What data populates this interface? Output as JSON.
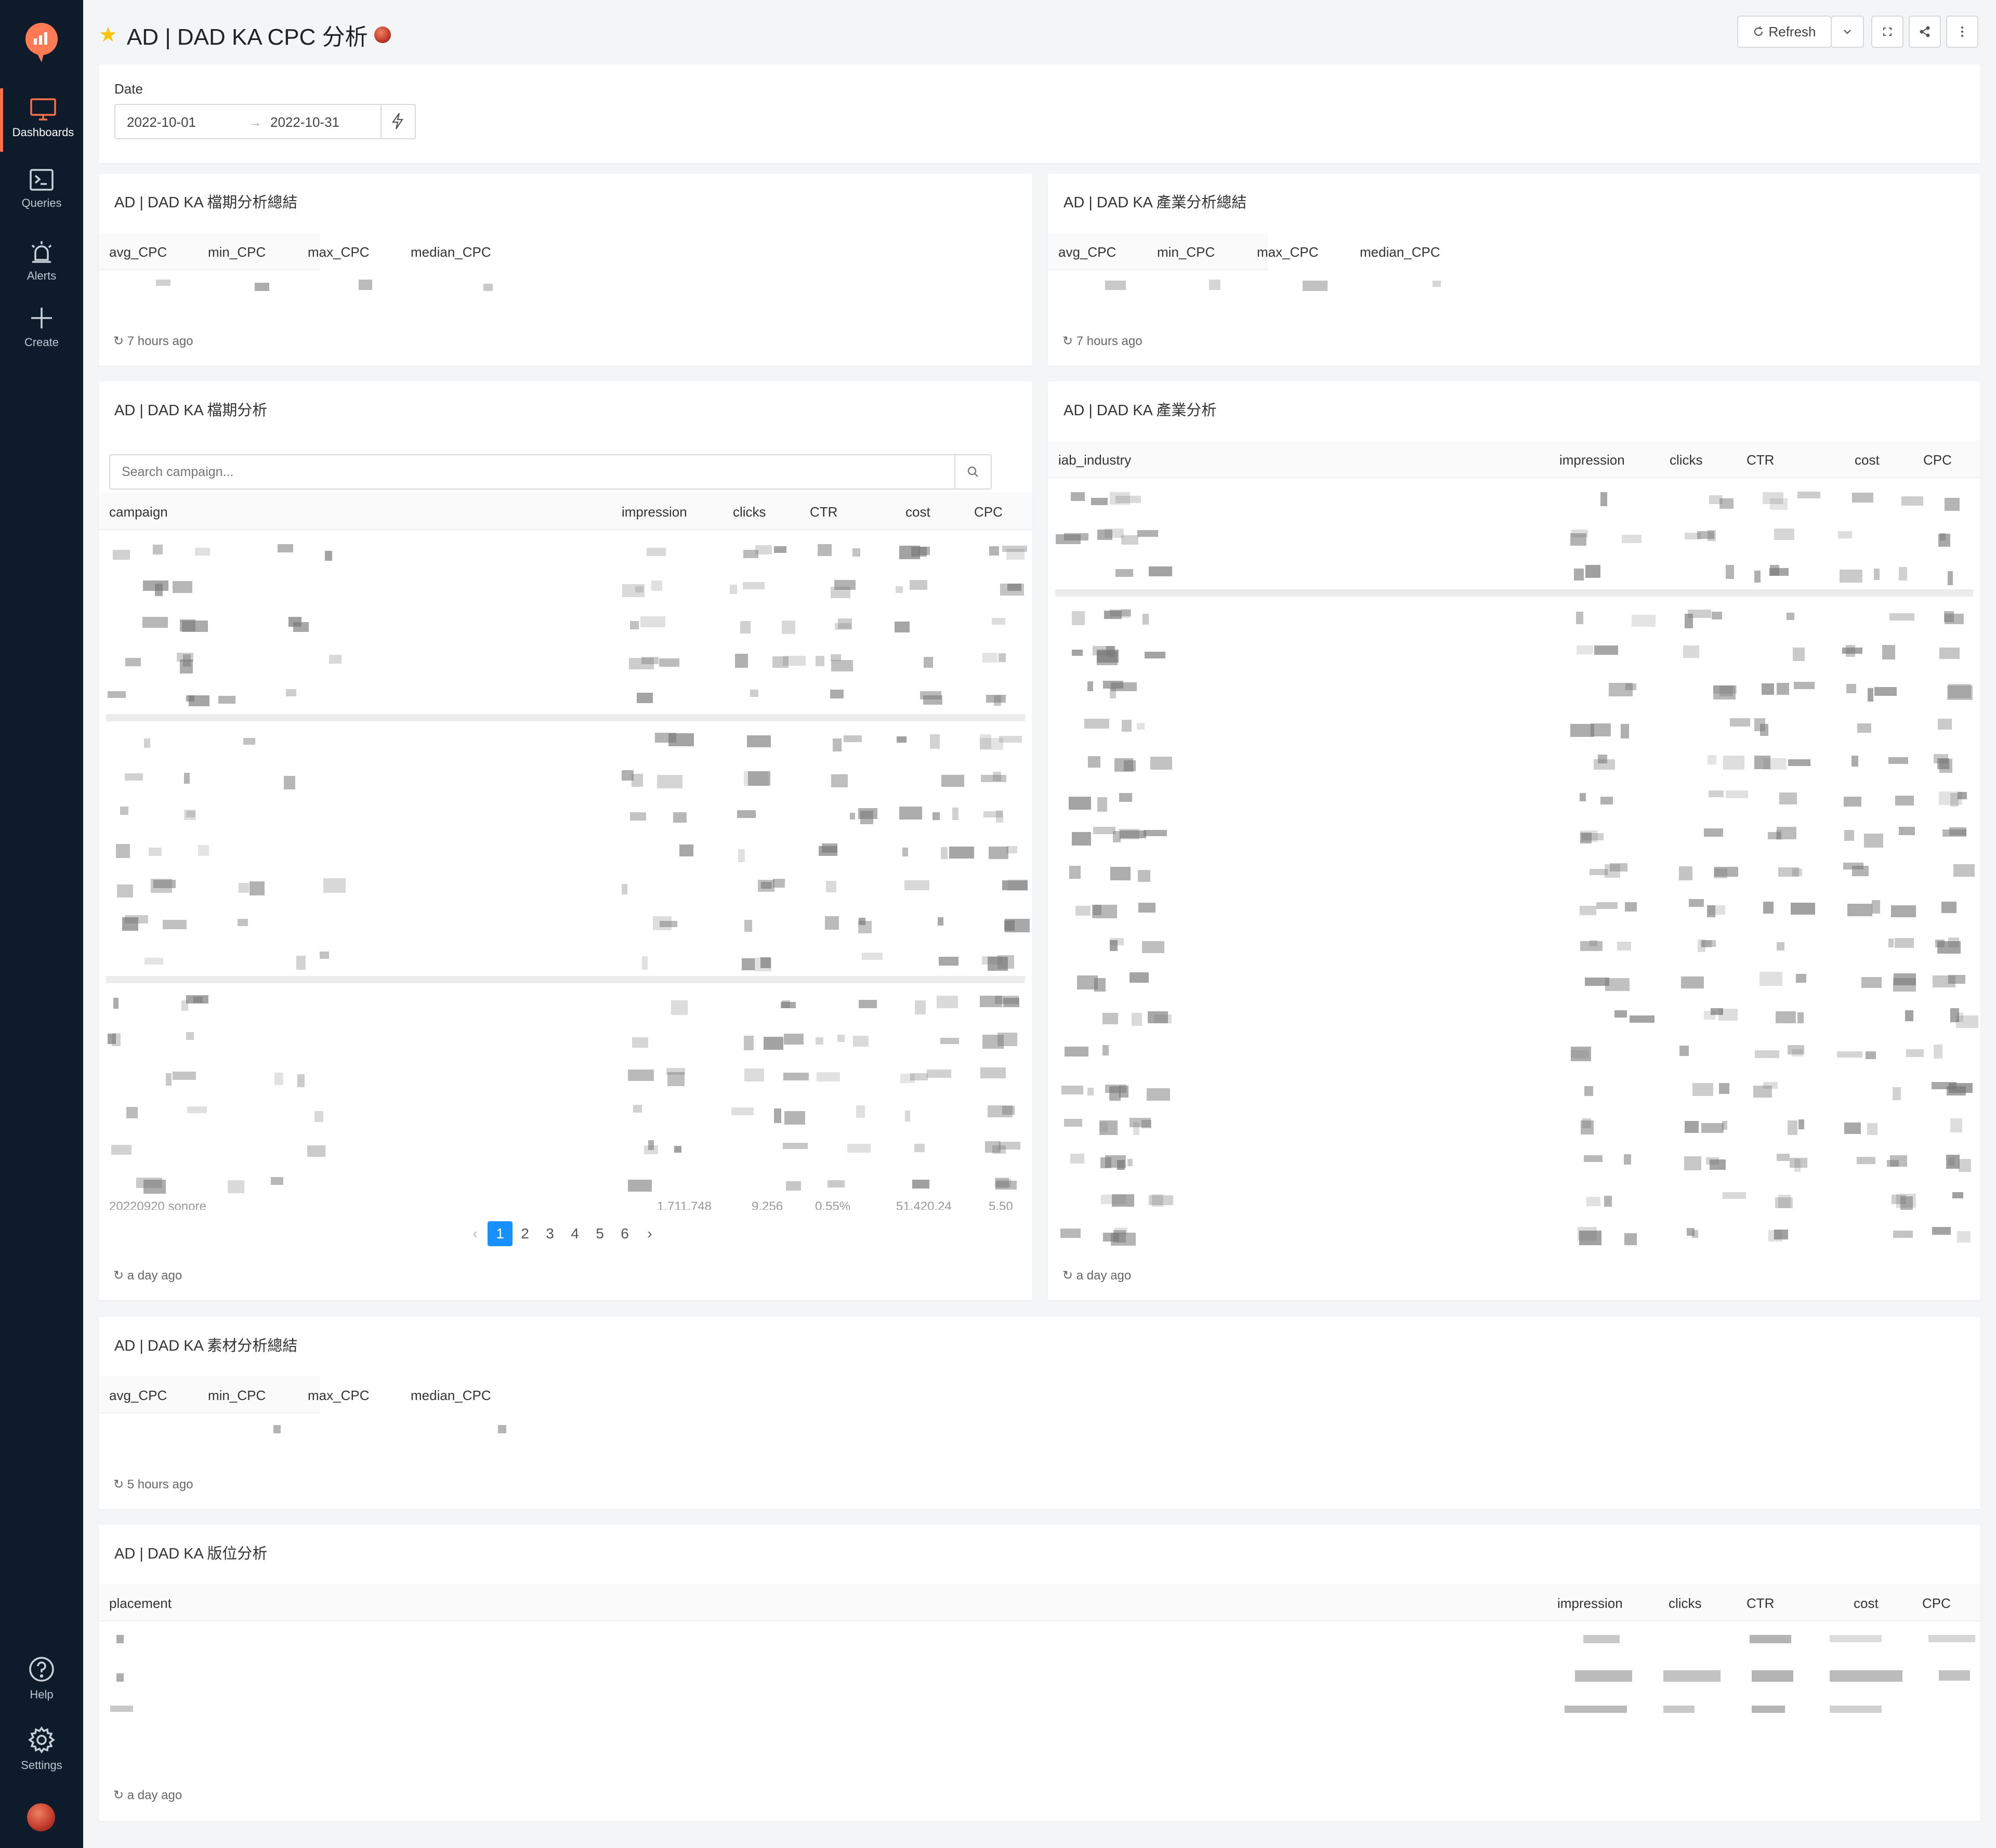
{
  "nav": {
    "dashboards": "Dashboards",
    "queries": "Queries",
    "alerts": "Alerts",
    "create": "Create",
    "help": "Help",
    "settings": "Settings"
  },
  "header": {
    "title": "AD | DAD KA CPC 分析",
    "refresh_label": "Refresh"
  },
  "filter": {
    "label": "Date",
    "start": "2022-10-01",
    "end": "2022-10-31",
    "arrow": "→"
  },
  "panels": {
    "period_summary": {
      "title": "AD | DAD KA 檔期分析總結",
      "columns": [
        "avg_CPC",
        "min_CPC",
        "max_CPC",
        "median_CPC"
      ],
      "updated": "7 hours ago"
    },
    "industry_summary": {
      "title": "AD | DAD KA 產業分析總結",
      "columns": [
        "avg_CPC",
        "min_CPC",
        "max_CPC",
        "median_CPC"
      ],
      "updated": "7 hours ago"
    },
    "period_analysis": {
      "title": "AD | DAD KA 檔期分析",
      "search_placeholder": "Search campaign...",
      "columns": [
        "campaign",
        "impression",
        "clicks",
        "CTR",
        "cost",
        "CPC"
      ],
      "partial_row": [
        "20220920 sonore",
        "1,711,748",
        "9,256",
        "0.55%",
        "51,420.24",
        "5.50"
      ],
      "pages": [
        "1",
        "2",
        "3",
        "4",
        "5",
        "6"
      ],
      "current_page": "1",
      "updated": "a day ago"
    },
    "industry_analysis": {
      "title": "AD | DAD KA 產業分析",
      "columns": [
        "iab_industry",
        "impression",
        "clicks",
        "CTR",
        "cost",
        "CPC"
      ],
      "updated": "a day ago"
    },
    "material_summary": {
      "title": "AD | DAD KA 素材分析總結",
      "columns": [
        "avg_CPC",
        "min_CPC",
        "max_CPC",
        "median_CPC"
      ],
      "updated": "5 hours ago"
    },
    "placement_analysis": {
      "title": "AD | DAD KA 版位分析",
      "columns": [
        "placement",
        "impression",
        "clicks",
        "CTR",
        "cost",
        "CPC"
      ],
      "updated": "a day ago"
    }
  },
  "colors": {
    "sidebar_bg": "#0d1b2a",
    "accent": "#ff6f4a",
    "pager_active": "#1890ff",
    "star": "#ffc400"
  }
}
